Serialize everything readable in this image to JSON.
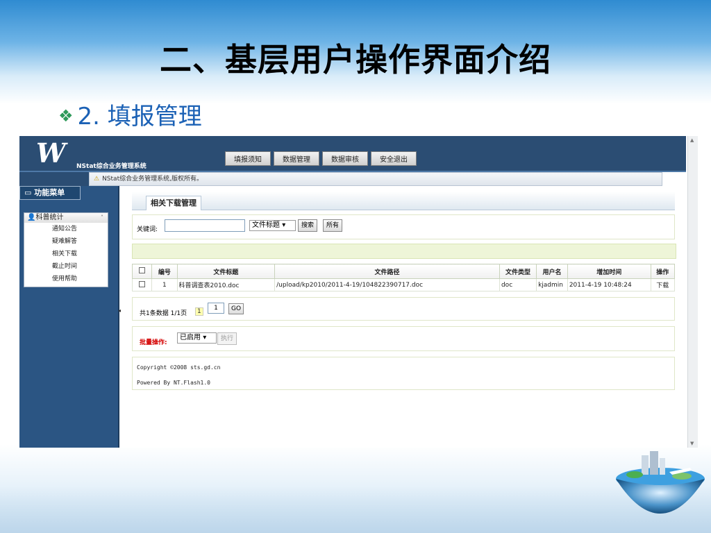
{
  "slide": {
    "title": "二、基层用户操作界面介绍",
    "subtitle": "2. 填报管理"
  },
  "app": {
    "logo": "W",
    "system_name": "NStat综合业务管理系统",
    "nav": [
      "填报须知",
      "数据管理",
      "数据审核",
      "安全退出"
    ],
    "notice": "NStat综合业务管理系统,版权所有。",
    "sidebar": {
      "header": "功能菜单",
      "group_title": "科普统计",
      "items": [
        "通知公告",
        "疑难解答",
        "相关下载",
        "截止时间",
        "使用帮助"
      ]
    },
    "tab_label": "相关下载管理",
    "search": {
      "keyword_label": "关键词:",
      "keyword_value": "",
      "field_select": "文件标题",
      "search_button": "搜索",
      "all_button": "所有"
    },
    "table": {
      "headers": [
        "编号",
        "文件标题",
        "文件路径",
        "文件类型",
        "用户名",
        "增加时间",
        "操作"
      ],
      "rows": [
        {
          "id": "1",
          "title": "科普调查表2010.doc",
          "path": "/upload/kp2010/2011-4-19/104822390717.doc",
          "type": "doc",
          "user": "kjadmin",
          "time": "2011-4-19 10:48:24",
          "action": "下载"
        }
      ]
    },
    "pager": {
      "summary": "共1条数据 1/1页",
      "current_page": "1",
      "input_value": "1",
      "go_button": "GO"
    },
    "batch": {
      "label": "批量操作:",
      "select_value": "已启用",
      "exec_button": "执行"
    },
    "footer": {
      "line1": "Copyright ©2008 sts.gd.cn",
      "line2": "Powered By NT.Flash1.0"
    }
  }
}
